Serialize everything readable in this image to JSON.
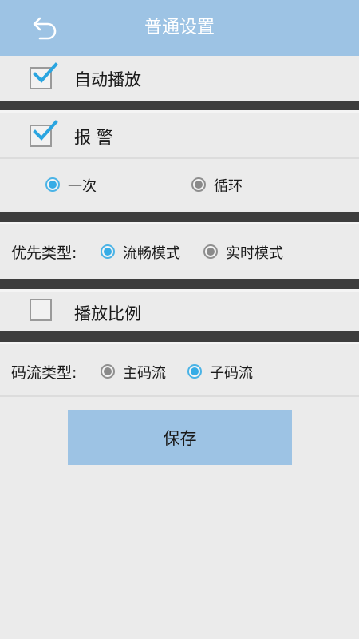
{
  "header": {
    "title": "普通设置",
    "back_icon": "undo-arrow-icon"
  },
  "autoplay": {
    "label": "自动播放",
    "checked": true
  },
  "alarm": {
    "label": "报 警",
    "checked": true,
    "options": [
      {
        "label": "一次",
        "selected": true
      },
      {
        "label": "循环",
        "selected": false
      }
    ]
  },
  "priority": {
    "label": "优先类型:",
    "options": [
      {
        "label": "流畅模式",
        "selected": true
      },
      {
        "label": "实时模式",
        "selected": false
      }
    ]
  },
  "ratio": {
    "label": "播放比例",
    "checked": false
  },
  "stream": {
    "label": "码流类型:",
    "options": [
      {
        "label": "主码流",
        "selected": false
      },
      {
        "label": "子码流",
        "selected": true
      }
    ]
  },
  "save_label": "保存",
  "colors": {
    "accent": "#9dc3e4",
    "radio_on": "#36ace6",
    "check": "#2aa5e0",
    "divider": "#3d3d3d"
  }
}
